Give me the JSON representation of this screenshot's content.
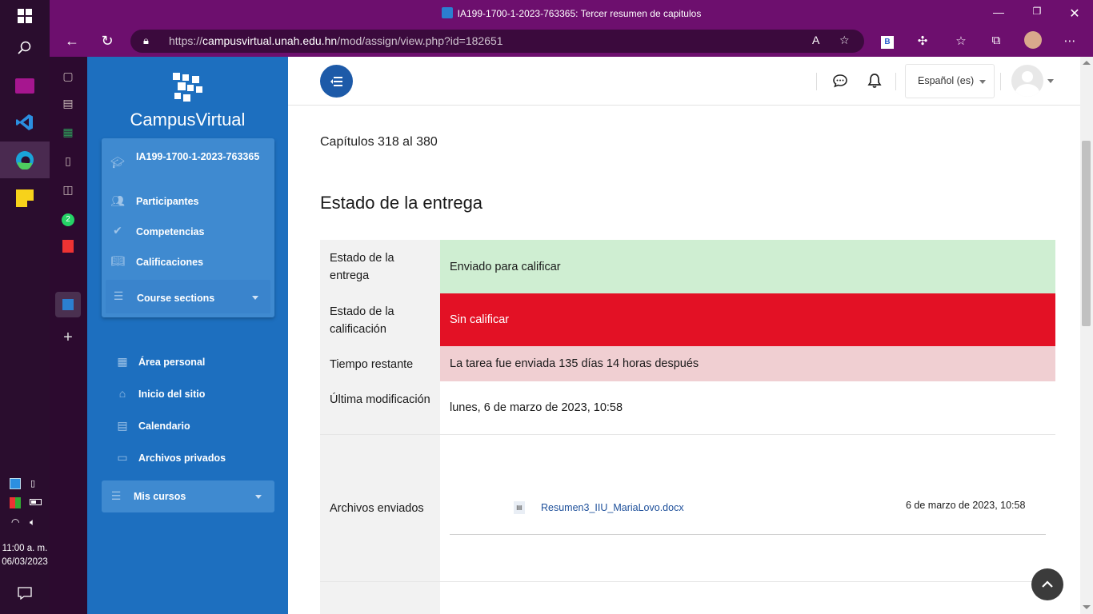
{
  "window": {
    "title": "IA199-1700-1-2023-763365: Tercer resumen de capitulos"
  },
  "browser": {
    "url_prefix": "https://",
    "url_domain": "campusvirtual.unah.edu.hn",
    "url_path": "/mod/assign/view.php?id=182651"
  },
  "taskbar": {
    "time": "11:00 a. m.",
    "date": "06/03/2023",
    "whatsapp_badge": "2"
  },
  "drawer": {
    "brand": "CampusVirtual",
    "course_code": "IA199-1700-1-2023-763365",
    "items": [
      {
        "label": "Participantes",
        "icon": "users-icon"
      },
      {
        "label": "Competencias",
        "icon": "check-icon"
      },
      {
        "label": "Calificaciones",
        "icon": "book-icon"
      }
    ],
    "course_sections": "Course sections",
    "links": [
      {
        "label": "Área personal",
        "icon": "dashboard-icon"
      },
      {
        "label": "Inicio del sitio",
        "icon": "home-icon"
      },
      {
        "label": "Calendario",
        "icon": "calendar-icon"
      },
      {
        "label": "Archivos privados",
        "icon": "drive-icon"
      }
    ],
    "mis_cursos": "Mis cursos"
  },
  "header": {
    "language": "Español (es)"
  },
  "content": {
    "chapters": "Capítulos 318 al 380",
    "section_title": "Estado de la entrega",
    "rows": [
      {
        "label": "Estado de la entrega",
        "value": "Enviado para calificar"
      },
      {
        "label": "Estado de la calificación",
        "value": "Sin calificar"
      },
      {
        "label": "Tiempo restante",
        "value": "La tarea fue enviada 135 días 14 horas después"
      },
      {
        "label": "Última modificación",
        "value": "lunes, 6 de marzo de 2023, 10:58"
      },
      {
        "label": "Archivos enviados",
        "file_name": "Resumen3_IIU_MariaLovo.docx",
        "file_date": "6 de marzo de 2023, 10:58"
      }
    ]
  },
  "colors": {
    "title_bar": "#6d0f6e",
    "drawer": "#1d6fbf",
    "submitted_bg": "#cfeed2",
    "ungraded_bg": "#e31125",
    "late_bg": "#f0cfd2"
  }
}
